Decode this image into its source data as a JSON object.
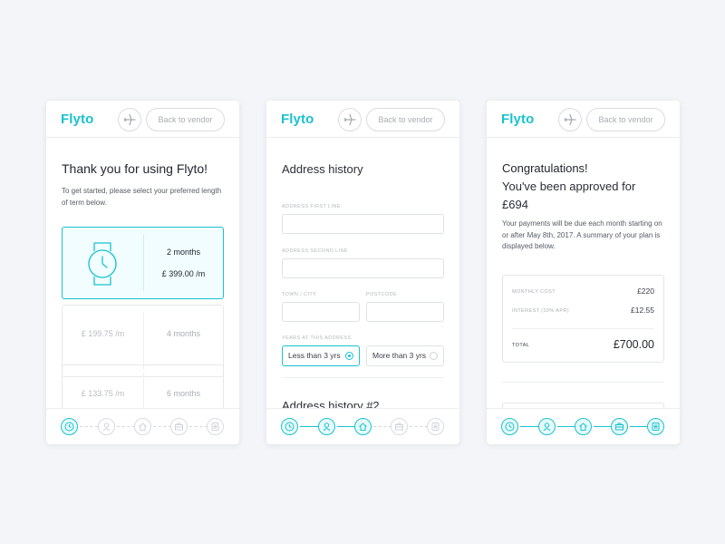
{
  "brand": {
    "name": "Flyto",
    "accent": "#19c2cf"
  },
  "header": {
    "back_label": "Back to vendor",
    "plane_icon": "airplane-icon"
  },
  "card1": {
    "title": "Thank you for using Flyto!",
    "description": "To get started, please select your preferred length of term below.",
    "options": [
      {
        "term": "2 months",
        "price": "£ 399.00 /m",
        "selected": true,
        "icon": "watch-icon"
      },
      {
        "term": "4 months",
        "price": "£ 199.75 /m",
        "selected": false
      },
      {
        "term": "6 months",
        "price": "£ 133.75 /m",
        "selected": false
      }
    ]
  },
  "card2": {
    "title": "Address history",
    "labels": {
      "first_line": "Address first line",
      "second_line": "Address second line",
      "town": "Town / City",
      "postcode": "Postcode",
      "years": "Years at this address"
    },
    "radios": [
      {
        "label": "Less than 3 yrs",
        "selected": true
      },
      {
        "label": "More than 3 yrs",
        "selected": false
      }
    ],
    "next_section": "Address history #2"
  },
  "card3": {
    "title": "Congratulations!",
    "approved_line": "You've been approved for",
    "amount": "£694",
    "description": "Your payments will be due each month starting on or after May 8th, 2017. A summary of your plan is displayed below.",
    "summary": {
      "monthly_cost_label": "Monthly cost",
      "monthly_cost": "£220",
      "interest_label": "Interest (10% APR)",
      "interest": "£12.55",
      "total_label": "Total",
      "total": "£700.00"
    }
  },
  "steps": [
    "clock-icon",
    "user-icon",
    "home-icon",
    "briefcase-icon",
    "bank-icon"
  ]
}
